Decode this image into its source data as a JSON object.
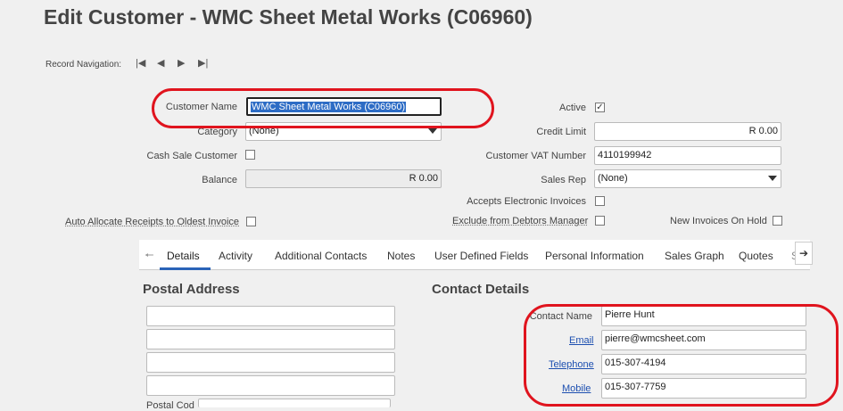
{
  "page": {
    "title": "Edit Customer - WMC Sheet Metal Works (C06960)"
  },
  "record_nav": {
    "label": "Record Navigation:",
    "first": "|◀",
    "prev": "◀",
    "next": "▶",
    "last": "▶|"
  },
  "form": {
    "customer_name": {
      "label": "Customer Name",
      "value": "WMC Sheet Metal Works (C06960)"
    },
    "category": {
      "label": "Category",
      "value": "(None)"
    },
    "cash_sale": {
      "label": "Cash Sale Customer",
      "checked": false
    },
    "balance": {
      "label": "Balance",
      "value": "R 0.00"
    },
    "auto_allocate": {
      "label": "Auto Allocate Receipts to Oldest Invoice",
      "checked": false
    },
    "active": {
      "label": "Active",
      "checked": true,
      "mark": "✓"
    },
    "credit_limit": {
      "label": "Credit Limit",
      "value": "R 0.00"
    },
    "vat_number": {
      "label": "Customer VAT Number",
      "value": "4110199942"
    },
    "sales_rep": {
      "label": "Sales Rep",
      "value": "(None)"
    },
    "accepts_electronic": {
      "label": "Accepts Electronic Invoices",
      "checked": false
    },
    "exclude_debtors": {
      "label": "Exclude from Debtors Manager",
      "checked": false
    },
    "new_invoices_hold": {
      "label": "New Invoices On Hold",
      "checked": false
    }
  },
  "tabs": {
    "items": [
      {
        "label": "Details",
        "active": true
      },
      {
        "label": "Activity"
      },
      {
        "label": "Additional Contacts"
      },
      {
        "label": "Notes"
      },
      {
        "label": "User Defined Fields"
      },
      {
        "label": "Personal Information"
      },
      {
        "label": "Sales Graph"
      },
      {
        "label": "Quotes"
      },
      {
        "label": "S"
      }
    ],
    "scroll_left": "🠔",
    "scroll_right": "➔"
  },
  "postal": {
    "heading": "Postal Address",
    "postal_code_label": "Postal Cod"
  },
  "contact": {
    "heading": "Contact Details",
    "contact_name": {
      "label": "Contact Name",
      "value": "Pierre Hunt"
    },
    "email": {
      "label": "Email",
      "value": "pierre@wmcsheet.com"
    },
    "telephone": {
      "label": "Telephone",
      "value": "015-307-4194"
    },
    "mobile": {
      "label": "Mobile",
      "value": "015-307-7759"
    }
  },
  "colors": {
    "highlight_oval": "#e0141e",
    "active_tab": "#2a63b8",
    "selection": "#2d6cc5"
  }
}
